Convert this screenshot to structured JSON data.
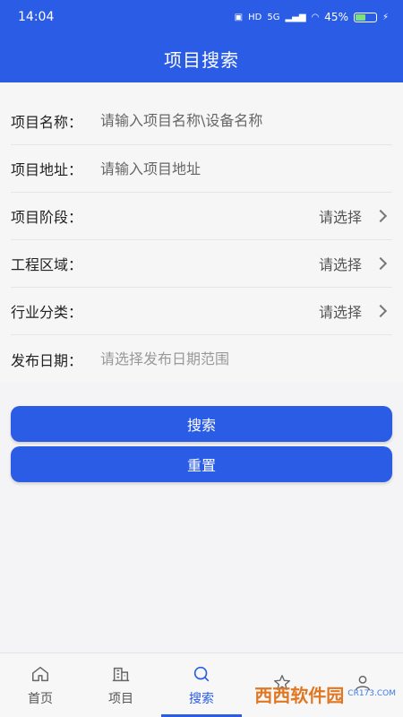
{
  "status": {
    "time": "14:04",
    "network": "5G",
    "battery": "45%"
  },
  "header": {
    "title": "项目搜索"
  },
  "form": {
    "project_name": {
      "label": "项目名称：",
      "placeholder": "请输入项目名称\\设备名称"
    },
    "project_address": {
      "label": "项目地址：",
      "placeholder": "请输入项目地址"
    },
    "project_stage": {
      "label": "项目阶段：",
      "value": "请选择"
    },
    "engineering_region": {
      "label": "工程区域：",
      "value": "请选择"
    },
    "industry_category": {
      "label": "行业分类：",
      "value": "请选择"
    },
    "publish_date": {
      "label": "发布日期：",
      "placeholder": "请选择发布日期范围"
    }
  },
  "buttons": {
    "search": "搜索",
    "reset": "重置"
  },
  "tabbar": {
    "items": [
      {
        "label": "首页",
        "icon": "home-icon"
      },
      {
        "label": "项目",
        "icon": "building-icon"
      },
      {
        "label": "搜索",
        "icon": "search-icon",
        "active": true
      },
      {
        "label": "",
        "icon": "star-icon"
      },
      {
        "label": "",
        "icon": "person-icon"
      }
    ]
  },
  "watermark": {
    "text": "西西软件园",
    "sub": "CR173.COM"
  },
  "colors": {
    "primary": "#2a5ce6",
    "background": "#f4f4f6"
  }
}
